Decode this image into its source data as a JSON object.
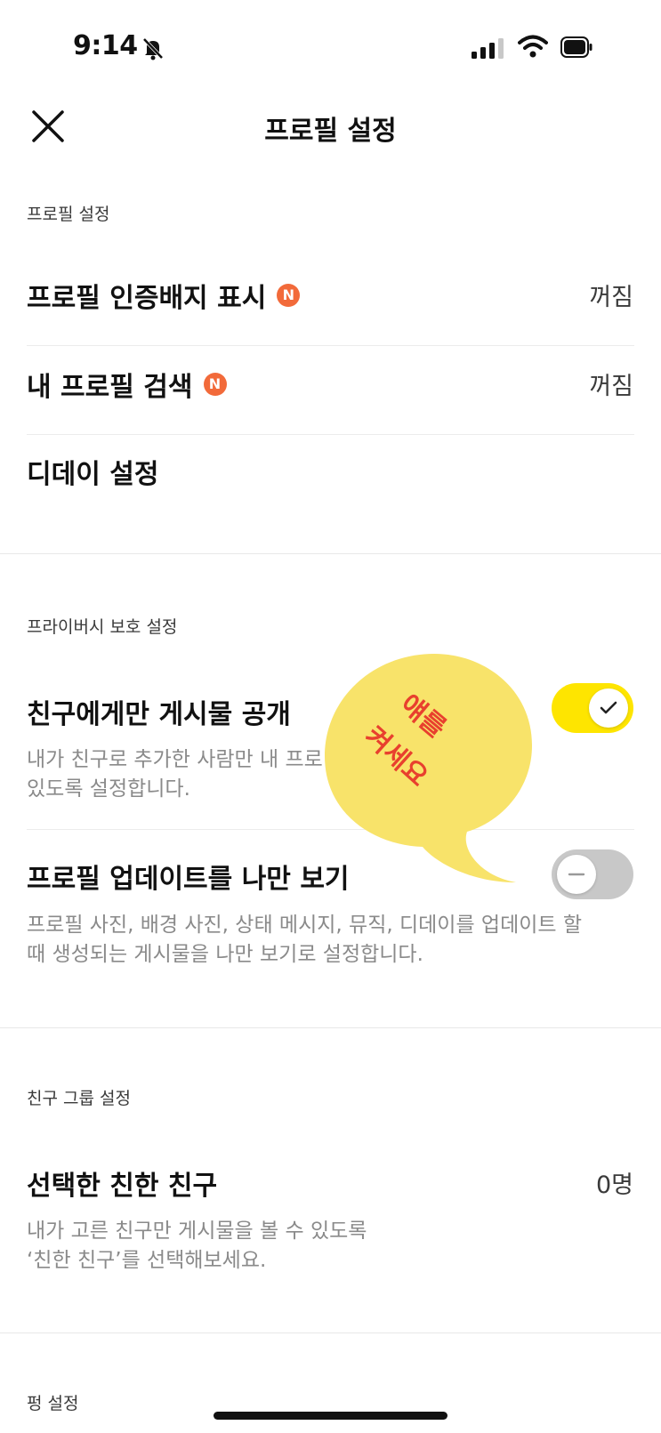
{
  "status_bar": {
    "time": "9:14"
  },
  "nav": {
    "title": "프로필 설정"
  },
  "sections": {
    "profile": {
      "header": "프로필 설정",
      "rows": [
        {
          "label": "프로필 인증배지 표시",
          "badge": "N",
          "value": "꺼짐"
        },
        {
          "label": "내 프로필 검색",
          "badge": "N",
          "value": "꺼짐"
        },
        {
          "label": "디데이 설정"
        }
      ]
    },
    "privacy": {
      "header": "프라이버시 보호 설정",
      "friends_only": {
        "label": "친구에게만 게시물 공개",
        "desc_line1": "내가 친구로 추가한 사람만 내 프로",
        "desc_line2": "있도록 설정합니다.",
        "enabled": true
      },
      "private_update": {
        "label": "프로필 업데이트를 나만 보기",
        "desc_line1": "프로필 사진, 배경 사진, 상태 메시지, 뮤직, 디데이를 업데이트 할",
        "desc_line2": "때 생성되는 게시물을 나만 보기로 설정합니다.",
        "enabled": false
      }
    },
    "friend_group": {
      "header": "친구 그룹 설정",
      "close_friends": {
        "label": "선택한 친한 친구",
        "value": "0명",
        "desc_line1": "내가 고른 친구만 게시물을 볼 수 있도록",
        "desc_line2": "‘친한 친구’를 선택해보세요."
      }
    },
    "pung": {
      "header": "펑 설정"
    }
  },
  "annotation": {
    "line1": "얘를",
    "line2": "켜세요"
  },
  "colors": {
    "accent_yellow": "#fee500",
    "badge_orange": "#f26a3a",
    "annotation_red": "#e8402e",
    "bubble_yellow": "#f8e36a"
  }
}
